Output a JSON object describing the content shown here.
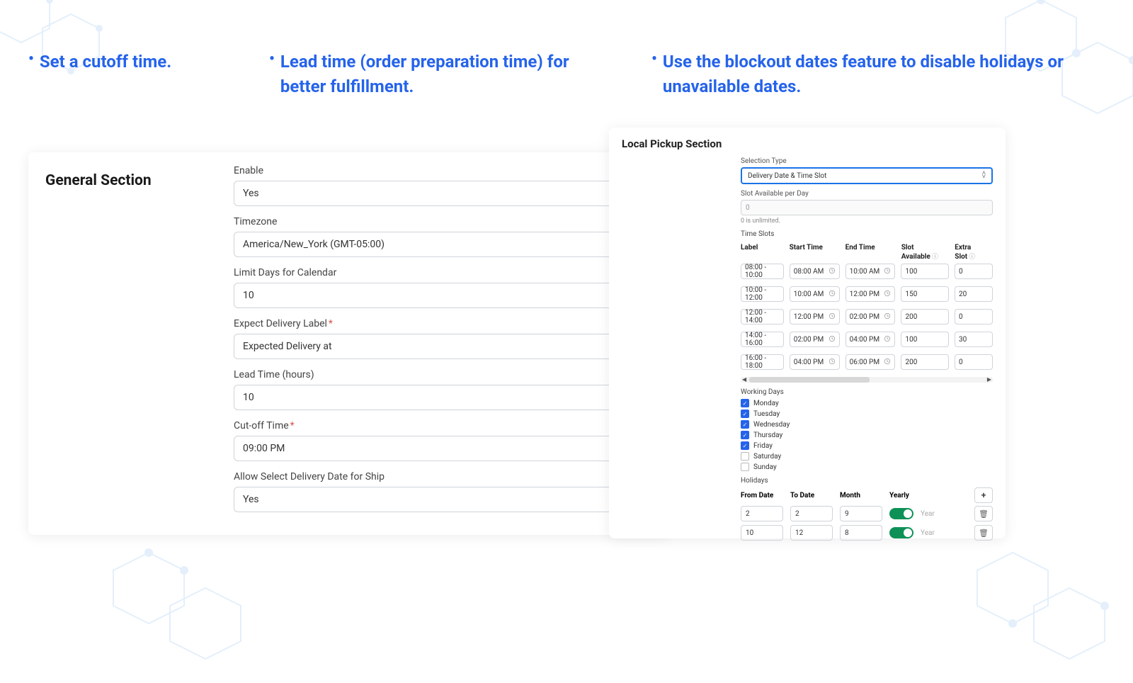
{
  "headlines": [
    "Set a cutoff time.",
    "Lead time (order preparation time) for better fulfillment.",
    "Use the blockout dates feature to disable holidays or unavailable dates."
  ],
  "general": {
    "title": "General Section",
    "fields": {
      "enable": {
        "label": "Enable",
        "value": "Yes"
      },
      "timezone": {
        "label": "Timezone",
        "value": "America/New_York (GMT-05:00)"
      },
      "limitDays": {
        "label": "Limit Days for Calendar",
        "value": "10"
      },
      "expectLabel": {
        "label": "Expect Delivery Label",
        "value": "Expected Delivery at",
        "required": true
      },
      "leadTime": {
        "label": "Lead Time (hours)",
        "value": "10"
      },
      "cutoff": {
        "label": "Cut-off Time",
        "value": "09:00 PM",
        "required": true
      },
      "allowShip": {
        "label": "Allow Select Delivery Date for Ship",
        "value": "Yes"
      }
    }
  },
  "pickup": {
    "title": "Local Pickup Section",
    "selectionType": {
      "label": "Selection Type",
      "value": "Delivery Date & Time Slot"
    },
    "slotPerDay": {
      "label": "Slot Available per Day",
      "value": "0",
      "hint": "0 is unlimited."
    },
    "timeSlots": {
      "heading": "Time Slots",
      "columns": [
        "Label",
        "Start Time",
        "End Time",
        "Slot Available",
        "Extra Slot"
      ],
      "rows": [
        {
          "label": "08:00 - 10:00",
          "start": "08:00 AM",
          "end": "10:00 AM",
          "avail": "100",
          "extra": "0"
        },
        {
          "label": "10:00 - 12:00",
          "start": "10:00 AM",
          "end": "12:00 PM",
          "avail": "150",
          "extra": "20"
        },
        {
          "label": "12:00 - 14:00",
          "start": "12:00 PM",
          "end": "02:00 PM",
          "avail": "200",
          "extra": "0"
        },
        {
          "label": "14:00 - 16:00",
          "start": "02:00 PM",
          "end": "04:00 PM",
          "avail": "100",
          "extra": "30"
        },
        {
          "label": "16:00 - 18:00",
          "start": "04:00 PM",
          "end": "06:00 PM",
          "avail": "200",
          "extra": "0"
        }
      ]
    },
    "workingDays": {
      "heading": "Working Days",
      "days": [
        {
          "name": "Monday",
          "checked": true
        },
        {
          "name": "Tuesday",
          "checked": true
        },
        {
          "name": "Wednesday",
          "checked": true
        },
        {
          "name": "Thursday",
          "checked": true
        },
        {
          "name": "Friday",
          "checked": true
        },
        {
          "name": "Saturday",
          "checked": false
        },
        {
          "name": "Sunday",
          "checked": false
        }
      ]
    },
    "holidays": {
      "heading": "Holidays",
      "columns": [
        "From Date",
        "To Date",
        "Month",
        "Yearly"
      ],
      "yearPlaceholder": "Year",
      "addLabel": "+",
      "rows": [
        {
          "from": "2",
          "to": "2",
          "month": "9",
          "yearly": true
        },
        {
          "from": "10",
          "to": "12",
          "month": "8",
          "yearly": true
        }
      ]
    }
  }
}
